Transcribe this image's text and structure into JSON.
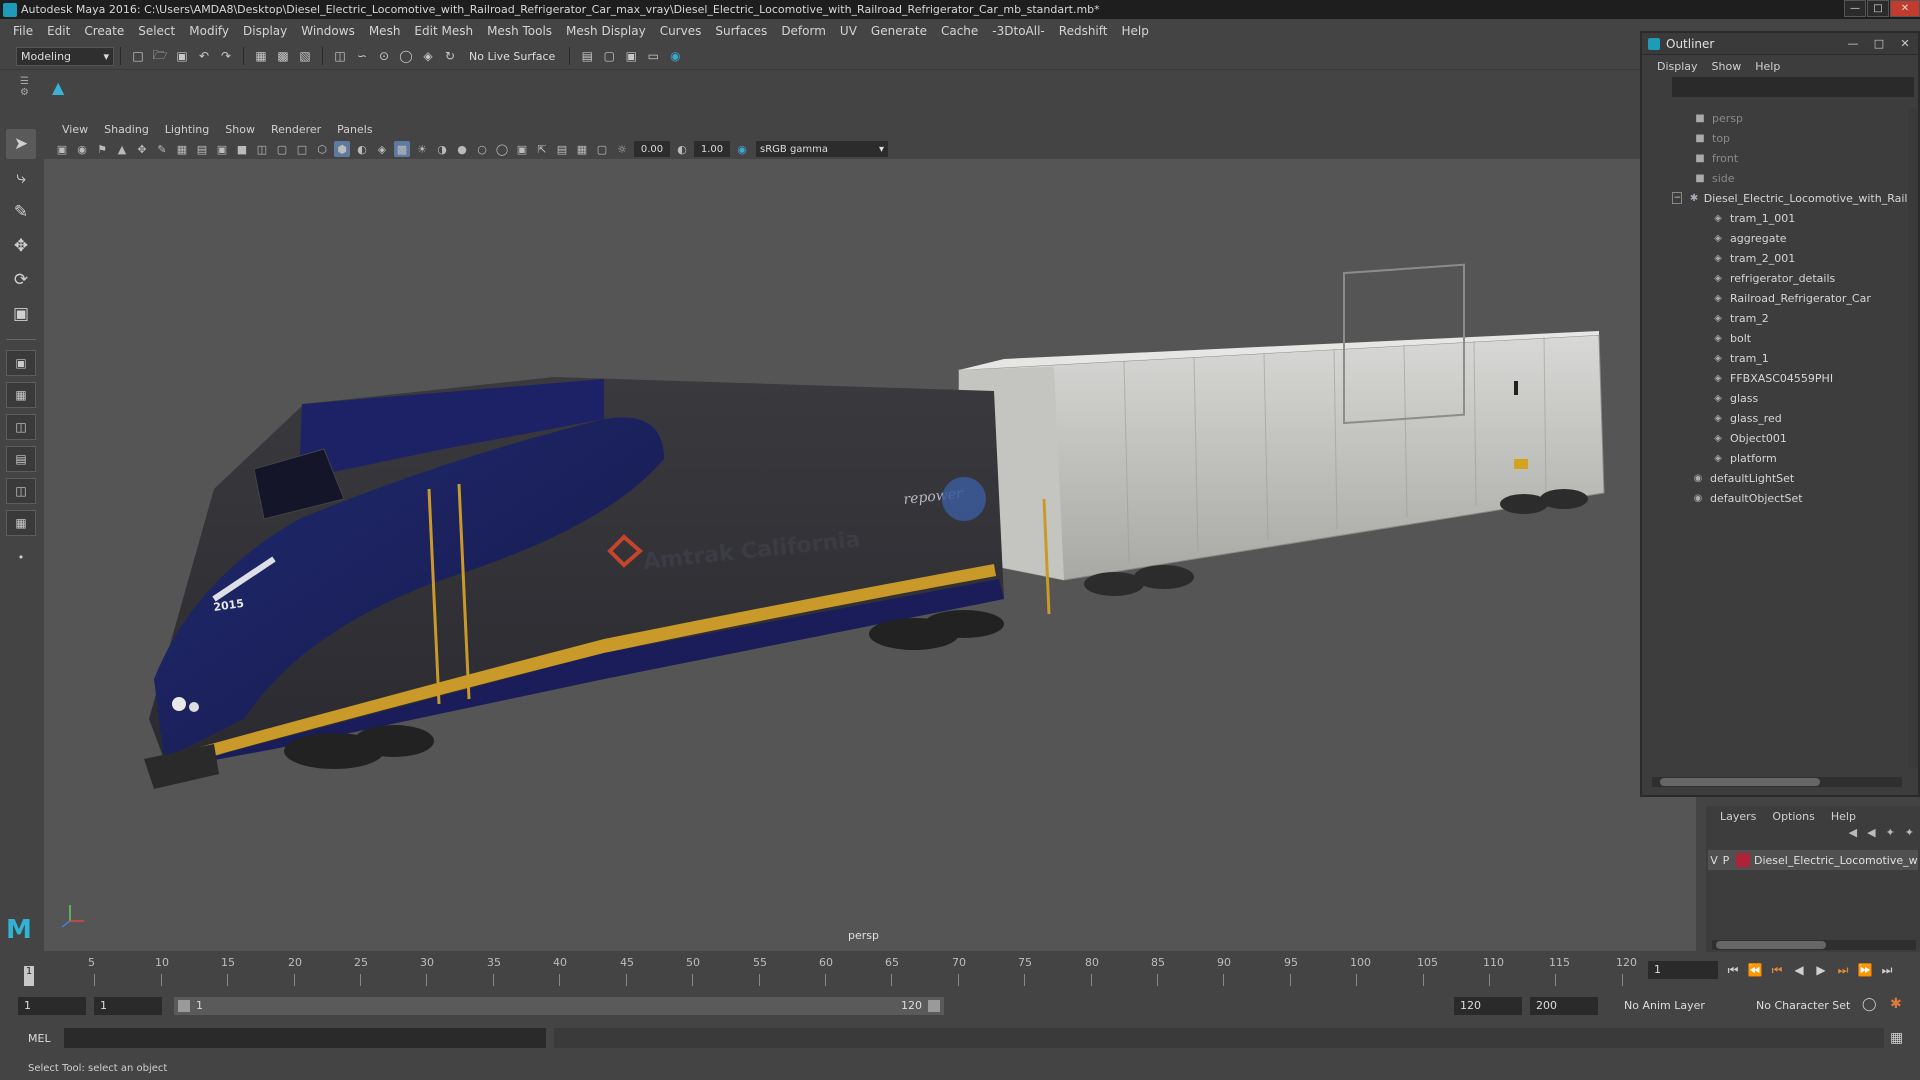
{
  "window": {
    "title": "Autodesk Maya 2016: C:\\Users\\AMDA8\\Desktop\\Diesel_Electric_Locomotive_with_Railroad_Refrigerator_Car_max_vray\\Diesel_Electric_Locomotive_with_Railroad_Refrigerator_Car_mb_standart.mb*"
  },
  "menubar": [
    "File",
    "Edit",
    "Create",
    "Select",
    "Modify",
    "Display",
    "Windows",
    "Mesh",
    "Edit Mesh",
    "Mesh Tools",
    "Mesh Display",
    "Curves",
    "Surfaces",
    "Deform",
    "UV",
    "Generate",
    "Cache",
    "-3DtoAll-",
    "Redshift",
    "Help"
  ],
  "statusline": {
    "mode": "Modeling",
    "live_surface": "No Live Surface"
  },
  "viewport": {
    "menu": [
      "View",
      "Shading",
      "Lighting",
      "Show",
      "Renderer",
      "Panels"
    ],
    "exposure": "0.00",
    "gamma_value": "1.00",
    "color_space": "sRGB gamma",
    "camera": "persp"
  },
  "outliner": {
    "title": "Outliner",
    "menu": [
      "Display",
      "Show",
      "Help"
    ],
    "cameras": [
      "persp",
      "top",
      "front",
      "side"
    ],
    "root": "Diesel_Electric_Locomotive_with_Railr",
    "children": [
      "tram_1_001",
      "aggregate",
      "tram_2_001",
      "refrigerator_details",
      "Railroad_Refrigerator_Car",
      "tram_2",
      "bolt",
      "tram_1",
      "FFBXASC04559PHI",
      "glass",
      "glass_red",
      "Object001",
      "platform"
    ],
    "sets": [
      "defaultLightSet",
      "defaultObjectSet"
    ]
  },
  "layers": {
    "menu": [
      "Layers",
      "Options",
      "Help"
    ],
    "layer_name": "Diesel_Electric_Locomotive_w",
    "layer_v": "V",
    "layer_p": "P",
    "layer_color": "#b0213a"
  },
  "timeline": {
    "ticks": [
      "5",
      "10",
      "15",
      "20",
      "25",
      "30",
      "35",
      "40",
      "45",
      "50",
      "55",
      "60",
      "65",
      "70",
      "75",
      "80",
      "85",
      "90",
      "95",
      "100",
      "105",
      "110",
      "115",
      "120"
    ],
    "current_frame": "1",
    "current_field": "1"
  },
  "range": {
    "start": "1",
    "playback_start": "1",
    "slider_start": "1",
    "slider_end": "120",
    "playback_end": "120",
    "end": "200",
    "anim_layer": "No Anim Layer",
    "character_set": "No Character Set"
  },
  "cmdline": {
    "language": "MEL"
  },
  "helpline": {
    "text": "Select Tool: select an object"
  }
}
